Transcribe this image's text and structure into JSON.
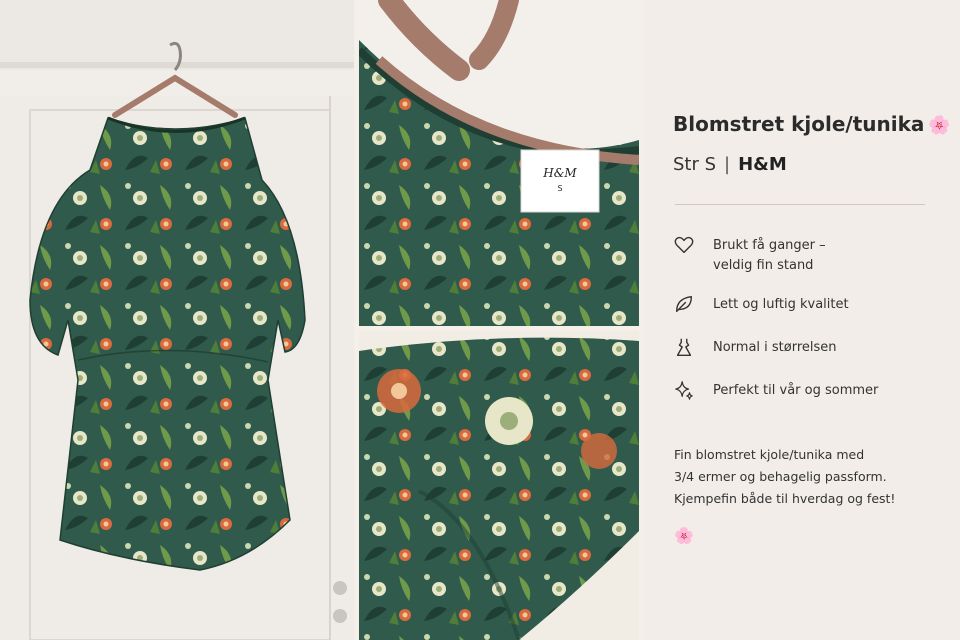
{
  "listing": {
    "title": "Blomstret kjole/tunika",
    "title_emoji": "🌸",
    "size": "Str S",
    "separator": "|",
    "brand": "H&M",
    "features": [
      {
        "icon": "heart-icon",
        "text": "Brukt få ganger –\nveldig fin stand"
      },
      {
        "icon": "leaf-icon",
        "text": "Lett og luftig kvalitet"
      },
      {
        "icon": "dress-icon",
        "text": "Normal i størrelsen"
      },
      {
        "icon": "sparkle-icon",
        "text": "Perfekt til vår og sommer"
      }
    ],
    "description": "Fin blomstret kjole/tunika med\n3/4 ermer og behagelig passform.\nKjempefin både til hverdag og fest!",
    "description_emoji": "🌸"
  },
  "photos": {
    "label_brand": "H&M",
    "label_size": "S"
  },
  "colors": {
    "fabric": "#2f5a4c",
    "fabric_dark": "#1f3f34",
    "flower_orange": "#d86a3d",
    "flower_cream": "#e8e6c8",
    "leaf_green": "#6f9a4a",
    "panel_bg": "#f2ede8",
    "wall": "#f1eeea"
  }
}
